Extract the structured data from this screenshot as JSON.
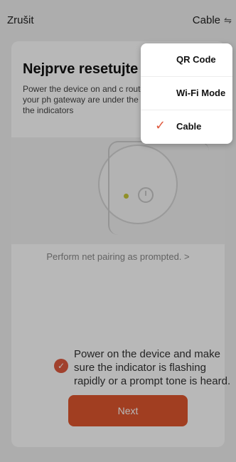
{
  "header": {
    "cancel_label": "Zrušit",
    "mode_label": "Cable",
    "mode_icon": "⇋"
  },
  "card": {
    "title": "Nejprve resetujte z",
    "description": "Power the device on and c router, making sure your ph gateway are under the sam confirm that the indicators",
    "prompt_link": "Perform net pairing as prompted. >",
    "confirm_text": "Power on the device and make sure the indicator is flashing rapidly or a prompt tone is heard.",
    "next_label": "Next"
  },
  "menu": {
    "items": [
      {
        "label": "QR Code",
        "checked": false
      },
      {
        "label": "Wi-Fi Mode",
        "checked": false
      },
      {
        "label": "Cable",
        "checked": true
      }
    ],
    "check_symbol": "✓"
  },
  "colors": {
    "accent": "#e0572f",
    "led": "#c8c83a"
  }
}
